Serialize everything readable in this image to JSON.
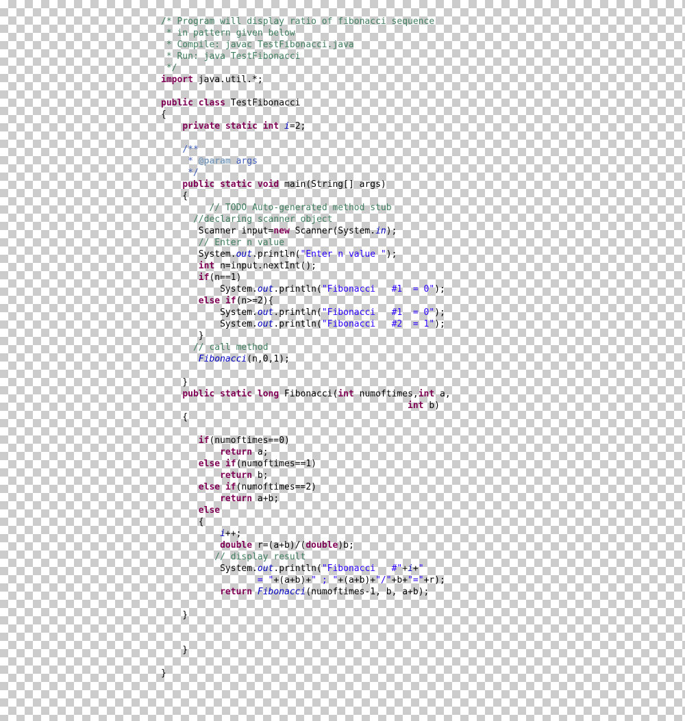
{
  "code": {
    "tokens": [
      {
        "t": "c",
        "v": "/* Program will display ratio of fibonacci sequence\n * in pattern given below\n * Compile: javac TestFibonacci.java\n * Run: java TestFibonacci\n */"
      },
      {
        "t": "",
        "v": "\n"
      },
      {
        "t": "k",
        "v": "import"
      },
      {
        "t": "",
        "v": " java.util.*;\n\n"
      },
      {
        "t": "k",
        "v": "public"
      },
      {
        "t": "",
        "v": " "
      },
      {
        "t": "k",
        "v": "class"
      },
      {
        "t": "",
        "v": " TestFibonacci\n{\n    "
      },
      {
        "t": "k",
        "v": "private"
      },
      {
        "t": "",
        "v": " "
      },
      {
        "t": "k",
        "v": "static"
      },
      {
        "t": "",
        "v": " "
      },
      {
        "t": "k",
        "v": "int"
      },
      {
        "t": "",
        "v": " "
      },
      {
        "t": "f",
        "v": "i"
      },
      {
        "t": "",
        "v": "=2;\n\n    "
      },
      {
        "t": "jd",
        "v": "/**\n     * "
      },
      {
        "t": "jdtag",
        "v": "@param"
      },
      {
        "t": "jd",
        "v": " args\n     */"
      },
      {
        "t": "",
        "v": "\n    "
      },
      {
        "t": "k",
        "v": "public"
      },
      {
        "t": "",
        "v": " "
      },
      {
        "t": "k",
        "v": "static"
      },
      {
        "t": "",
        "v": " "
      },
      {
        "t": "k",
        "v": "void"
      },
      {
        "t": "",
        "v": " main(String[] args)\n    {\n         "
      },
      {
        "t": "c",
        "v": "// TODO Auto-generated method stub"
      },
      {
        "t": "",
        "v": "\n      "
      },
      {
        "t": "c",
        "v": "//declaring scanner object"
      },
      {
        "t": "",
        "v": "\n       Scanner input="
      },
      {
        "t": "k",
        "v": "new"
      },
      {
        "t": "",
        "v": " Scanner(System."
      },
      {
        "t": "f",
        "v": "in"
      },
      {
        "t": "",
        "v": ");\n       "
      },
      {
        "t": "c",
        "v": "// Enter n value"
      },
      {
        "t": "",
        "v": "\n       System."
      },
      {
        "t": "f",
        "v": "out"
      },
      {
        "t": "",
        "v": ".println("
      },
      {
        "t": "s",
        "v": "\"Enter n value \""
      },
      {
        "t": "",
        "v": ");\n       "
      },
      {
        "t": "k",
        "v": "int"
      },
      {
        "t": "",
        "v": " n=input.nextInt();\n       "
      },
      {
        "t": "k",
        "v": "if"
      },
      {
        "t": "",
        "v": "(n==1)\n           System."
      },
      {
        "t": "f",
        "v": "out"
      },
      {
        "t": "",
        "v": ".println("
      },
      {
        "t": "s",
        "v": "\"Fibonacci   #1  = 0\""
      },
      {
        "t": "",
        "v": ");\n       "
      },
      {
        "t": "k",
        "v": "else"
      },
      {
        "t": "",
        "v": " "
      },
      {
        "t": "k",
        "v": "if"
      },
      {
        "t": "",
        "v": "(n>=2){\n           System."
      },
      {
        "t": "f",
        "v": "out"
      },
      {
        "t": "",
        "v": ".println("
      },
      {
        "t": "s",
        "v": "\"Fibonacci   #1  = 0\""
      },
      {
        "t": "",
        "v": ");\n           System."
      },
      {
        "t": "f",
        "v": "out"
      },
      {
        "t": "",
        "v": ".println("
      },
      {
        "t": "s",
        "v": "\"Fibonacci   #2  = 1\""
      },
      {
        "t": "",
        "v": ");\n       }\n      "
      },
      {
        "t": "c",
        "v": "// call method"
      },
      {
        "t": "",
        "v": "\n       "
      },
      {
        "t": "f",
        "v": "Fibonacci"
      },
      {
        "t": "",
        "v": "(n,0,1);\n\n    }\n    "
      },
      {
        "t": "k",
        "v": "public"
      },
      {
        "t": "",
        "v": " "
      },
      {
        "t": "k",
        "v": "static"
      },
      {
        "t": "",
        "v": " "
      },
      {
        "t": "k",
        "v": "long"
      },
      {
        "t": "",
        "v": " Fibonacci("
      },
      {
        "t": "k",
        "v": "int"
      },
      {
        "t": "",
        "v": " numoftimes,"
      },
      {
        "t": "k",
        "v": "int"
      },
      {
        "t": "",
        "v": " a,\n                                              "
      },
      {
        "t": "k",
        "v": "int"
      },
      {
        "t": "",
        "v": " b)\n    {\n\n       "
      },
      {
        "t": "k",
        "v": "if"
      },
      {
        "t": "",
        "v": "(numoftimes==0)\n           "
      },
      {
        "t": "k",
        "v": "return"
      },
      {
        "t": "",
        "v": " a;\n       "
      },
      {
        "t": "k",
        "v": "else"
      },
      {
        "t": "",
        "v": " "
      },
      {
        "t": "k",
        "v": "if"
      },
      {
        "t": "",
        "v": "(numoftimes==1)\n           "
      },
      {
        "t": "k",
        "v": "return"
      },
      {
        "t": "",
        "v": " b;\n       "
      },
      {
        "t": "k",
        "v": "else"
      },
      {
        "t": "",
        "v": " "
      },
      {
        "t": "k",
        "v": "if"
      },
      {
        "t": "",
        "v": "(numoftimes==2)\n           "
      },
      {
        "t": "k",
        "v": "return"
      },
      {
        "t": "",
        "v": " a+b;\n       "
      },
      {
        "t": "k",
        "v": "else"
      },
      {
        "t": "",
        "v": "\n       {\n           "
      },
      {
        "t": "f",
        "v": "i"
      },
      {
        "t": "",
        "v": "++;\n           "
      },
      {
        "t": "k",
        "v": "double"
      },
      {
        "t": "",
        "v": " r=(a+b)/("
      },
      {
        "t": "k",
        "v": "double"
      },
      {
        "t": "",
        "v": ")b;\n          "
      },
      {
        "t": "c",
        "v": "// display result"
      },
      {
        "t": "",
        "v": "\n           System."
      },
      {
        "t": "f",
        "v": "out"
      },
      {
        "t": "",
        "v": ".println("
      },
      {
        "t": "s",
        "v": "\"Fibonacci   #\""
      },
      {
        "t": "",
        "v": "+"
      },
      {
        "t": "f",
        "v": "i"
      },
      {
        "t": "",
        "v": "+"
      },
      {
        "t": "s",
        "v": "\"\n                  = \""
      },
      {
        "t": "",
        "v": "+(a+b)+"
      },
      {
        "t": "s",
        "v": "\" ; \""
      },
      {
        "t": "",
        "v": "+(a+b)+"
      },
      {
        "t": "s",
        "v": "\"/\""
      },
      {
        "t": "",
        "v": "+b+"
      },
      {
        "t": "s",
        "v": "\"=\""
      },
      {
        "t": "",
        "v": "+r);\n           "
      },
      {
        "t": "k",
        "v": "return"
      },
      {
        "t": "",
        "v": " "
      },
      {
        "t": "f",
        "v": "Fibonacci"
      },
      {
        "t": "",
        "v": "(numoftimes-1, b, a+b);\n\n    }\n\n\n    }\n\n}"
      }
    ]
  }
}
